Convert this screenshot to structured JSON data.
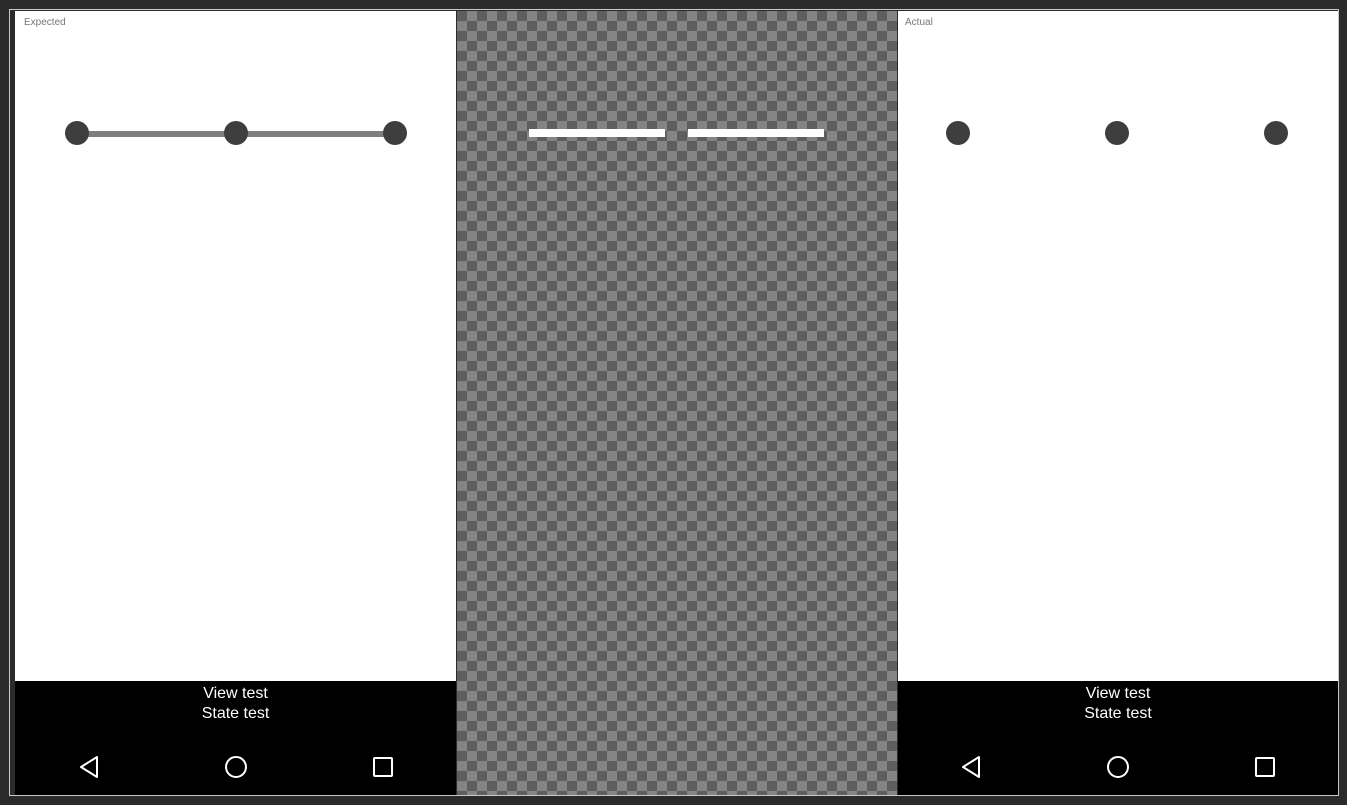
{
  "panels": {
    "expected": {
      "title": "Expected"
    },
    "actual": {
      "title": "Actual"
    }
  },
  "system_bar": {
    "lines": [
      "View test",
      "State test"
    ]
  },
  "nav_icons": [
    "back-icon",
    "home-icon",
    "recents-icon"
  ],
  "colors": {
    "dot": "#3e3e3e",
    "connector": "#7f7f7f",
    "diff_mark": "#ffffff",
    "system_bar_bg": "#000000"
  }
}
